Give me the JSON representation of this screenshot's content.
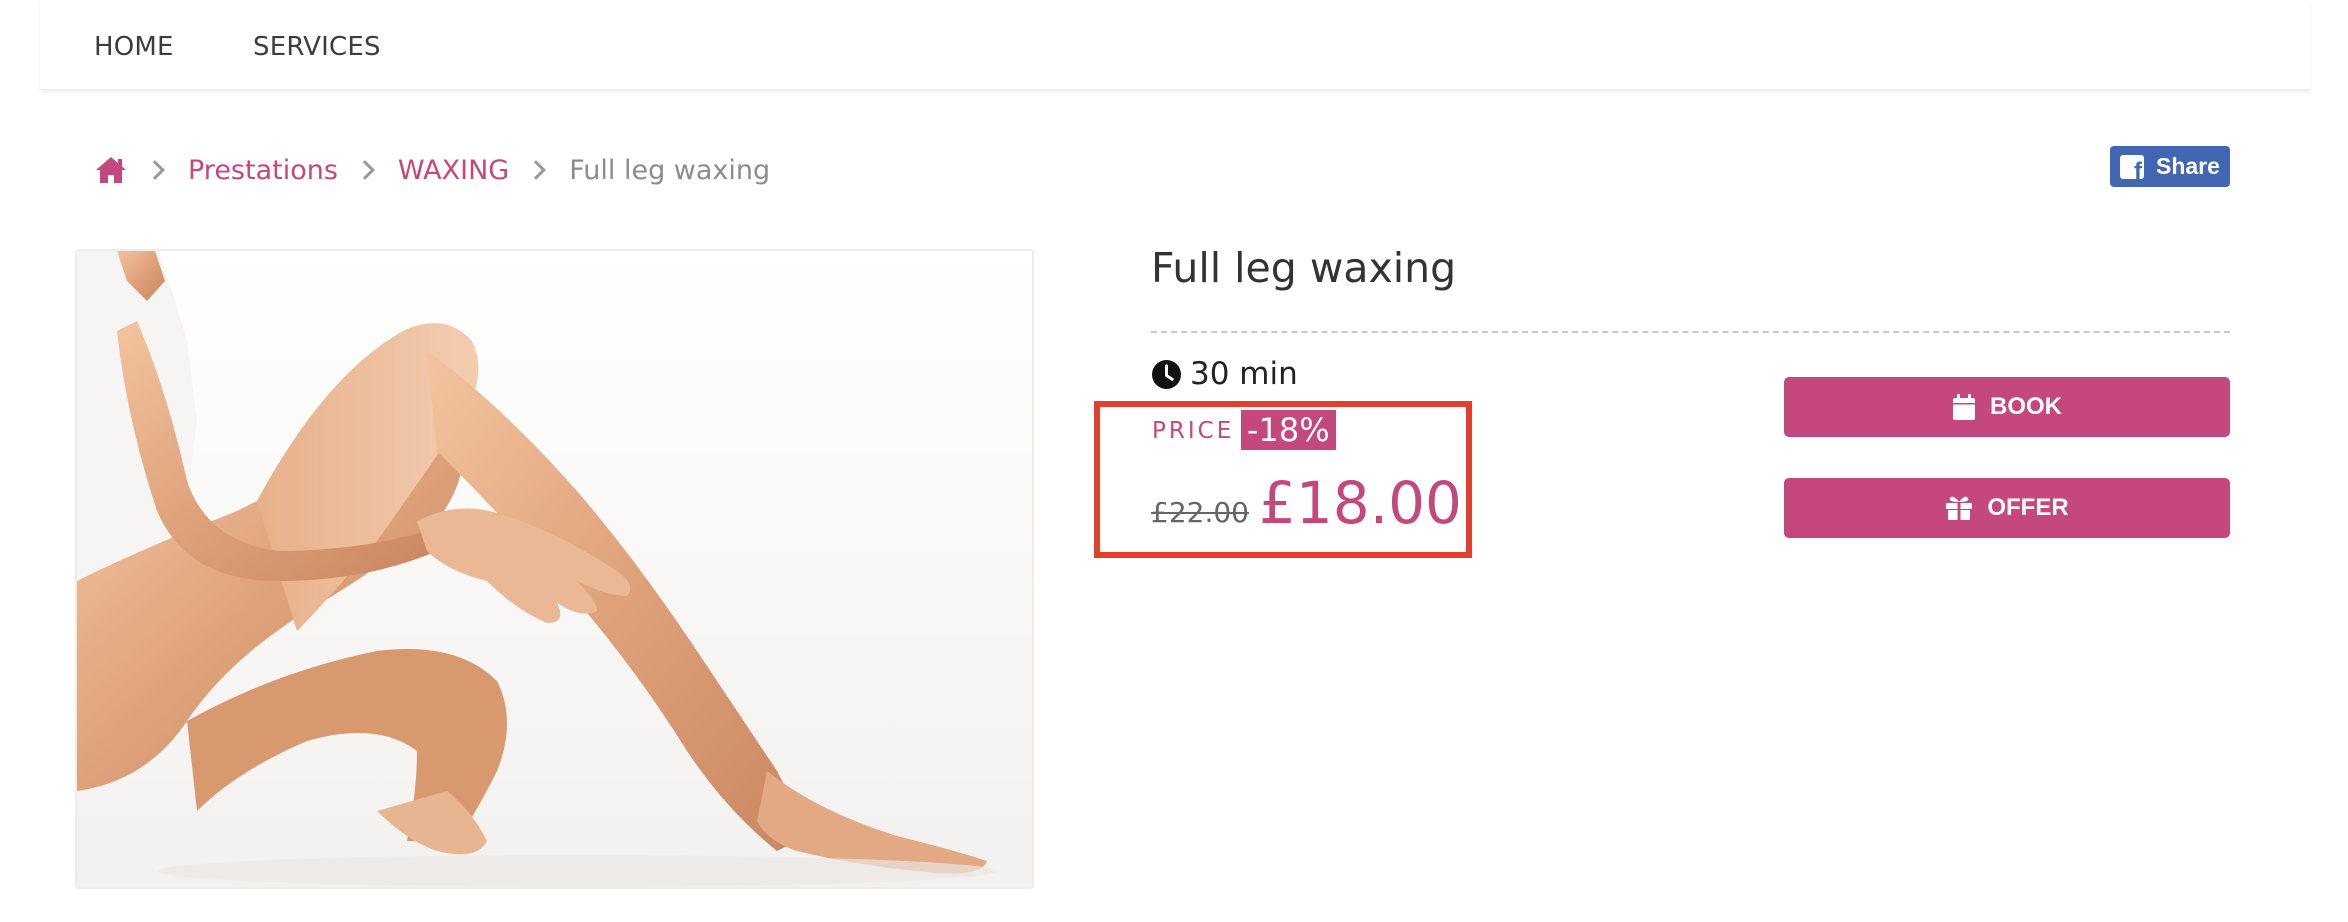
{
  "nav": {
    "items": [
      {
        "label": "HOME"
      },
      {
        "label": "SERVICES"
      }
    ]
  },
  "breadcrumb": {
    "home_icon": "home-icon",
    "items": [
      {
        "label": "Prestations"
      },
      {
        "label": "WAXING"
      }
    ],
    "current": "Full leg waxing"
  },
  "share": {
    "label": "Share",
    "icon": "facebook-icon",
    "color": "#4267b2"
  },
  "product": {
    "title": "Full leg waxing",
    "duration": "30 min",
    "price_label": "PRICE",
    "discount": "-18%",
    "old_price": "£22.00",
    "new_price": "£18.00"
  },
  "actions": {
    "book_label": "BOOK",
    "book_icon": "calendar-icon",
    "offer_label": "OFFER",
    "offer_icon": "gift-icon"
  },
  "colors": {
    "accent": "#c4487d",
    "highlight_border": "#e1402e"
  }
}
